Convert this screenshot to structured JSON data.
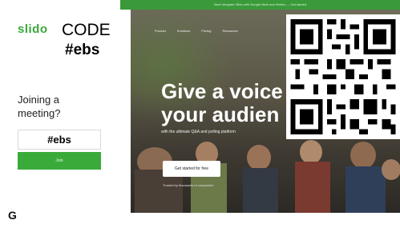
{
  "banner": {
    "text": "New! Integrate Slido with Google Meet and Webex — Get started"
  },
  "left": {
    "logo": "slido",
    "code_label": "CODE",
    "code_value": "#ebs",
    "joining": "Joining a meeting?",
    "input_value": "#ebs",
    "join_button": "Join"
  },
  "hero": {
    "nav": [
      "Product",
      "Solutions",
      "Pricing",
      "Resources"
    ],
    "headline_line1": "Give a voice",
    "headline_line2": "your audien",
    "subline": "with the ultimate Q&A and polling platform",
    "cta": "Get started for free",
    "note": "Trusted by thousands of companies"
  },
  "bottom_icon": "G"
}
